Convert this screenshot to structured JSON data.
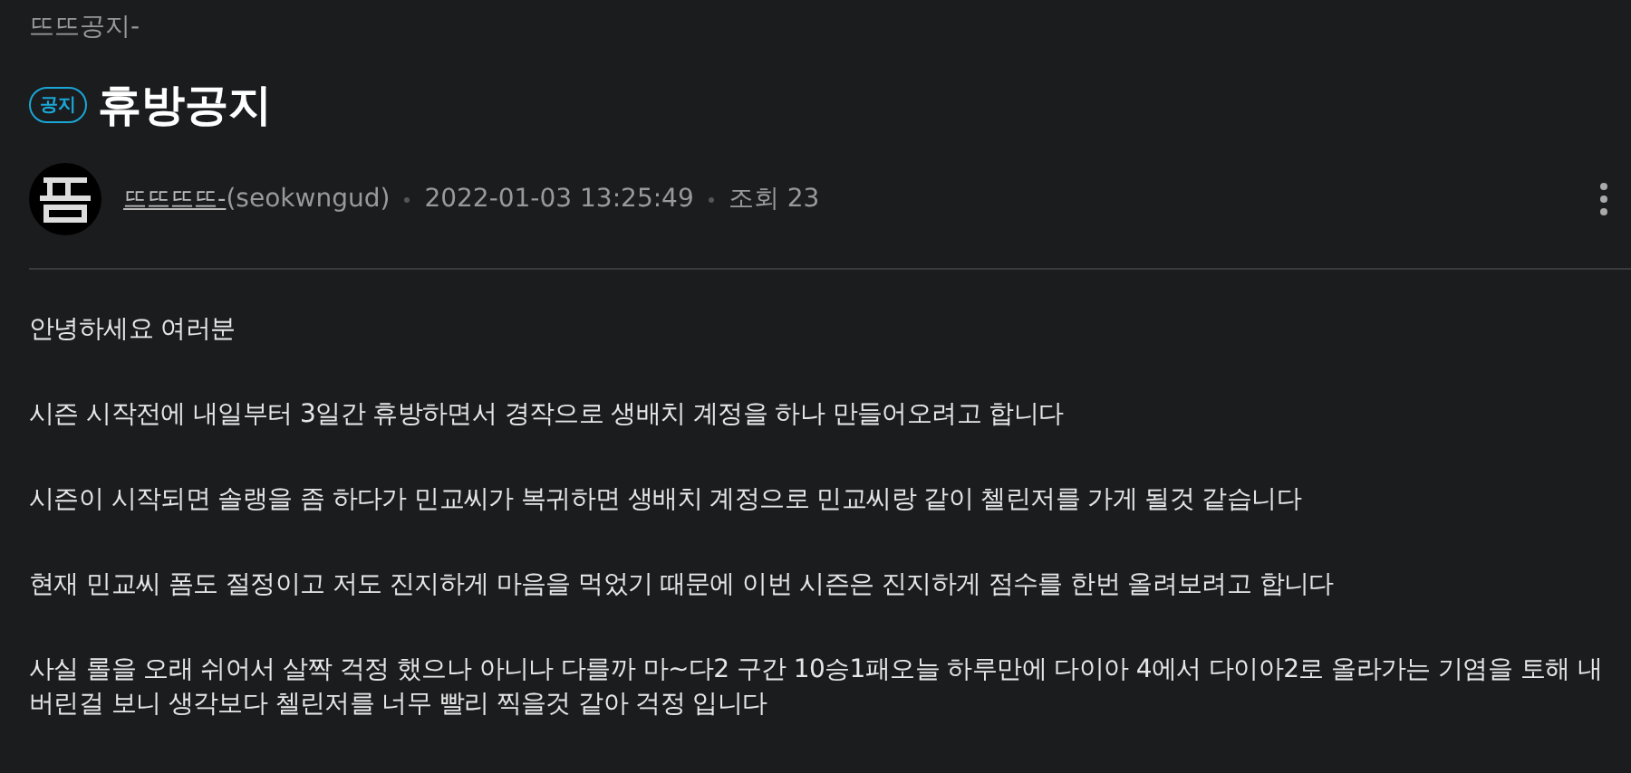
{
  "board": "뜨뜨공지-",
  "post": {
    "badge": "공지",
    "title": "휴방공지"
  },
  "author": {
    "name": "뜨뜨뜨뜨-",
    "id": "(seokwngud)",
    "date": "2022-01-03 13:25:49",
    "views": "조회 23"
  },
  "paragraphs": [
    "안녕하세요 여러분",
    "시즌 시작전에 내일부터 3일간 휴방하면서 경작으로 생배치 계정을 하나 만들어오려고 합니다",
    "시즌이 시작되면 솔랭을 좀 하다가 민교씨가 복귀하면 생배치 계정으로 민교씨랑 같이 첼린저를 가게 될것 같습니다",
    "현재 민교씨 폼도 절정이고 저도 진지하게 마음을 먹었기 때문에 이번 시즌은 진지하게 점수를 한번 올려보려고 합니다",
    "사실 롤을 오래 쉬어서 살짝 걱정 했으나 아니나 다를까 마~다2 구간 10승1패오늘 하루만에 다이아 4에서 다이아2로 올라가는  기염을 토해 내버린걸 보니 생각보다 첼린저를 너무 빨리 찍을것 같아 걱정 입니다"
  ]
}
